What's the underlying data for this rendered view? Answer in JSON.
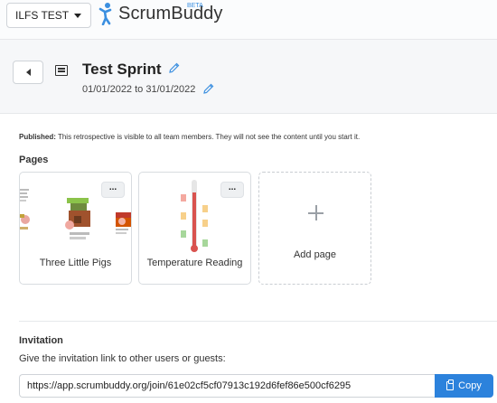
{
  "topbar": {
    "team_label": "ILFS TEST",
    "brand": "ScrumBuddy",
    "beta": "BETA"
  },
  "header": {
    "title": "Test Sprint",
    "dates": "01/01/2022 to 31/01/2022"
  },
  "notice": {
    "bold": "Published:",
    "text": "This retrospective is visible to all team members. They will not see the content until you start it."
  },
  "pages": {
    "label": "Pages",
    "items": [
      {
        "name": "Three Little Pigs",
        "menu": "..."
      },
      {
        "name": "Temperature Reading",
        "menu": "..."
      }
    ],
    "add_label": "Add page"
  },
  "invitation": {
    "label": "Invitation",
    "description": "Give the invitation link to other users or guests:",
    "link": "https://app.scrumbuddy.org/join/61e02cf5cf07913c192d6fef86e500cf6295",
    "copy_label": "Copy"
  },
  "colors": {
    "accent": "#2c82dc",
    "pencil": "#3b8fe0"
  }
}
